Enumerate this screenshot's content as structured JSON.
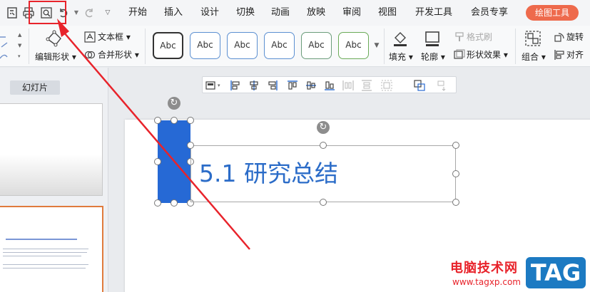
{
  "quick_access": {
    "icons": [
      "save-icon",
      "print-icon",
      "print-preview-icon",
      "undo-icon",
      "redo-icon",
      "customize-icon"
    ]
  },
  "tabs": [
    "开始",
    "插入",
    "设计",
    "切换",
    "动画",
    "放映",
    "审阅",
    "视图",
    "开发工具",
    "会员专享"
  ],
  "active_tab": "绘图工具",
  "ribbon": {
    "edit_shape": "编辑形状",
    "text_box": "文本框",
    "merge_shape": "合并形状",
    "style_preset": "Abc",
    "fill": "填充",
    "outline": "轮廓",
    "format_painter": "格式刷",
    "shape_effect": "形状效果",
    "group": "组合",
    "rotate": "旋转",
    "align": "对齐"
  },
  "style_presets": [
    {
      "text": "Abc",
      "border": "#333333"
    },
    {
      "text": "Abc",
      "border": "#5b8fd1"
    },
    {
      "text": "Abc",
      "border": "#5b8fd1"
    },
    {
      "text": "Abc",
      "border": "#5b8fd1"
    },
    {
      "text": "Abc",
      "border": "#6a9c7a"
    },
    {
      "text": "Abc",
      "border": "#6aab58"
    }
  ],
  "left_panel": {
    "tab_label": "幻灯片"
  },
  "slide": {
    "title": "5.1 研究总结",
    "title_color": "#2b6cc8",
    "shape_color": "#2669d5"
  },
  "annotation": {
    "color": "#e8232b"
  },
  "watermark": {
    "site_name": "电脑技术网",
    "url": "www.tagxp.com",
    "tag": "TAG"
  }
}
